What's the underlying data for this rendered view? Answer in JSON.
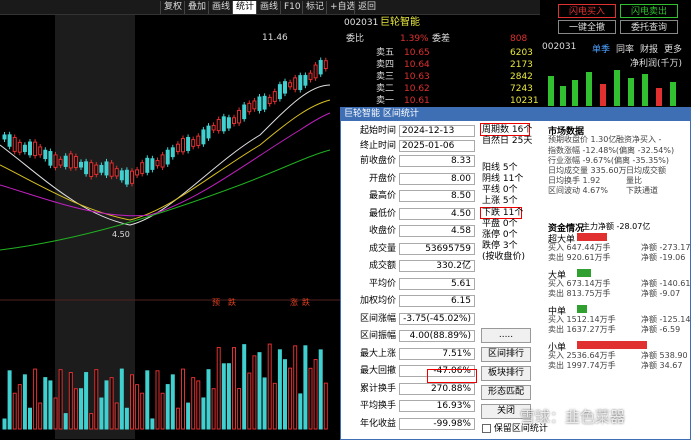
{
  "toolbar": {
    "items": [
      "复权",
      "叠加",
      "画线",
      "统计",
      "画线",
      "F10",
      "标记",
      "+自选",
      "返回"
    ]
  },
  "kchart": {
    "peak_label": "11.46",
    "trough_label": "4.50",
    "bottom_markers": [
      "预",
      "跌",
      "涨",
      "跌"
    ]
  },
  "quote": {
    "stock": "002031",
    "stock_name": "巨轮智能",
    "wei_bi_label": "委比",
    "wei_bi_value": "1.39%",
    "wei_cha_label": "委差",
    "wei_cha_value": "808",
    "asks": [
      {
        "label": "卖五",
        "price": "10.65",
        "vol": "6203"
      },
      {
        "label": "卖四",
        "price": "10.64",
        "vol": "2173"
      },
      {
        "label": "卖三",
        "price": "10.63",
        "vol": "2842"
      },
      {
        "label": "卖二",
        "price": "10.62",
        "vol": "7243"
      },
      {
        "label": "卖一",
        "price": "10.61",
        "vol": "10231"
      }
    ]
  },
  "rpanel": {
    "flash_buy": "闪电买入",
    "flash_sell": "闪电卖出",
    "one_click": "一键全撤",
    "check": "委托查询",
    "code": "002031",
    "single_season": "单季",
    "same_ratio": "同率",
    "financial": "财报",
    "more": "更多",
    "chart_title": "净利润(千万)"
  },
  "dialog": {
    "title": "巨轮智能 区间统计",
    "start_label": "起始时间",
    "start_value": "2024-12-13",
    "end_label": "终止时间",
    "end_value": "2025-01-06",
    "fields": [
      {
        "label": "前收盘价",
        "value": "8.33"
      },
      {
        "label": "开盘价",
        "value": "8.00"
      },
      {
        "label": "最高价",
        "value": "8.50"
      },
      {
        "label": "最低价",
        "value": "4.50"
      },
      {
        "label": "收盘价",
        "value": "4.58"
      },
      {
        "label": "成交量",
        "value": "53695759"
      },
      {
        "label": "成交额",
        "value": "330.2亿"
      },
      {
        "label": "平均价",
        "value": "5.61"
      },
      {
        "label": "加权均价",
        "value": "6.15"
      },
      {
        "label": "区间涨幅",
        "value": "-3.75(-45.02%)"
      },
      {
        "label": "区间振幅",
        "value": "4.00(88.89%)"
      },
      {
        "label": "最大上涨",
        "value": "7.51%"
      },
      {
        "label": "最大回撤",
        "value": "-47.06%"
      },
      {
        "label": "累计换手",
        "value": "270.88%"
      },
      {
        "label": "平均换手",
        "value": "16.93%"
      },
      {
        "label": "年化收益",
        "value": "-99.98%"
      }
    ],
    "period": [
      "周期数 16个",
      "自然日 25天"
    ],
    "counts": [
      "阳线 5个",
      "阴线 11个",
      "平线 0个",
      "上涨 5个",
      "下跌 11个",
      "平盘 0个",
      "涨停 0个",
      "跌停 3个",
      "(按收盘价)"
    ],
    "buttons": [
      ".....",
      "区间排行",
      "板块排行",
      "形态匹配",
      "关闭"
    ],
    "checkbox_label": "保留区间统计",
    "market_title": "市场数据",
    "market_lines": [
      "预期收盘价 1.30亿",
      "融资净买入 -",
      "指数涨幅 -12.48%(偏离 -32.54%)",
      "行业涨幅 -9.67%(偏离 -35.35%)",
      "日均成交量 335.60万",
      "日均成交额",
      "日均换手 1.92",
      "量比",
      "区间波动 4.67%",
      "下跌通道"
    ],
    "capital_title": "资金情况",
    "capital_main": "主力净额 -28.07亿",
    "super_title": "超大单",
    "super": [
      "买入 647.44万手",
      "卖出 920.61万手",
      "净额 -273.17",
      "净额 -19.06"
    ],
    "big_title": "大单",
    "big": [
      "买入 673.14万手",
      "卖出 813.75万手",
      "净额 -140.61",
      "净额 -9.07"
    ],
    "mid_title": "中单",
    "mid": [
      "买入 1512.14万手",
      "卖出 1637.27万手",
      "净额 -125.14",
      "净额 -6.59"
    ],
    "small_title": "小单",
    "small": [
      "买入 2536.64万手",
      "卖出 1997.74万手",
      "净额 538.90",
      "净额 34.67"
    ]
  },
  "watermark": "雪球：韭色菜器"
}
